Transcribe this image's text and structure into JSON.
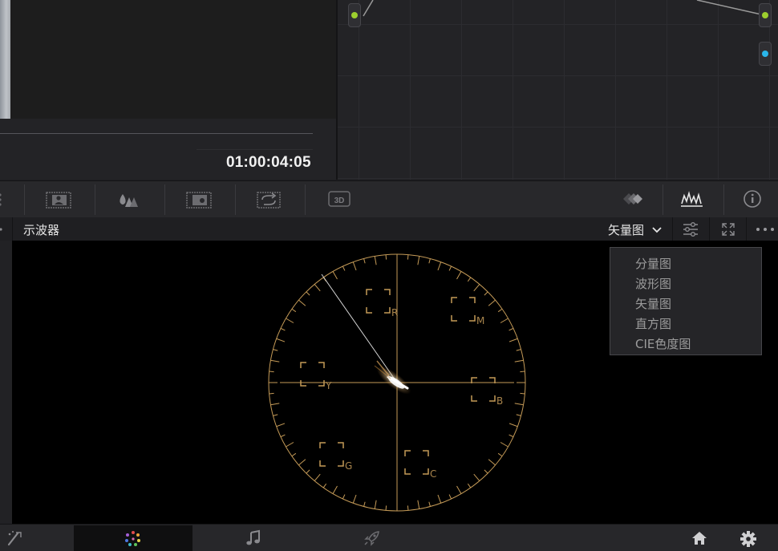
{
  "viewer": {
    "timecode": "01:00:04:05"
  },
  "toolbar": {
    "icons": [
      "grip-icon",
      "image-icon",
      "color-drops-icon",
      "viewer-icon",
      "loop-icon",
      "3d-icon",
      "keyframe-icon",
      "scopes-icon",
      "info-icon"
    ],
    "label_3d": "3D"
  },
  "scope": {
    "title": "示波器",
    "selected": "矢量图",
    "menu": [
      "分量图",
      "波形图",
      "矢量图",
      "直方图",
      "CIE色度图"
    ],
    "targets": {
      "R": "R",
      "M": "M",
      "B": "B",
      "C": "C",
      "G": "G",
      "Y": "Y"
    },
    "graticule_color": "#c49a57"
  },
  "page_nav": {
    "pages": [
      "edit-tools-icon",
      "color-wheel-icon",
      "music-note-icon",
      "rocket-icon"
    ],
    "active": "color-wheel-icon",
    "right": [
      "home-icon",
      "gear-icon"
    ]
  },
  "colors": {
    "node_green": "#9ccf2e",
    "node_blue": "#2ab6ea"
  }
}
